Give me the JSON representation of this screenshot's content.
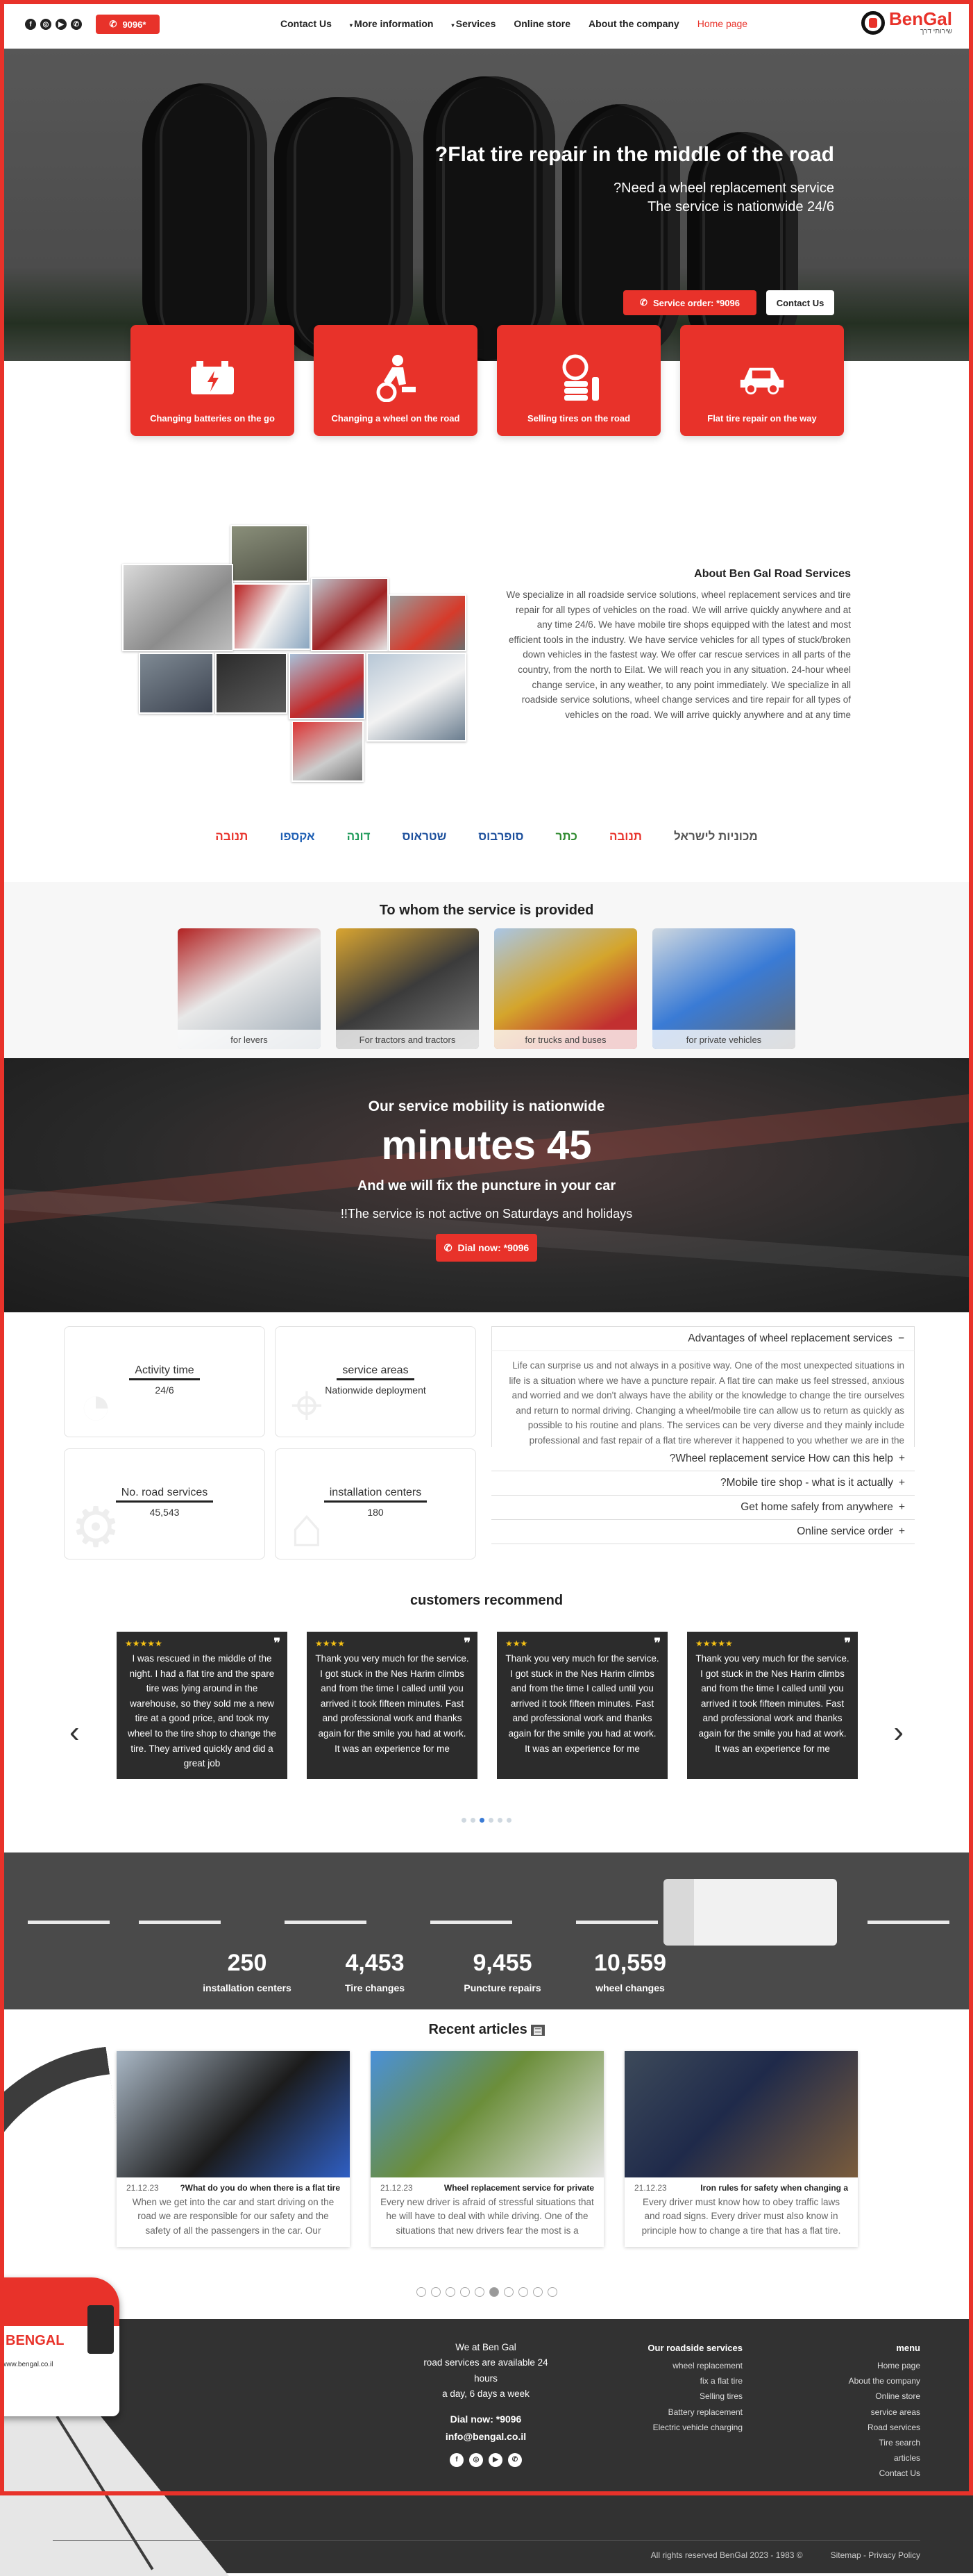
{
  "header": {
    "call_label": "9096*",
    "nav": [
      "Contact Us",
      "More information",
      "Services",
      "Online store",
      "About the company",
      "Home page"
    ],
    "logo_name": "BenGal",
    "logo_tagline": "שירותי דרך"
  },
  "hero": {
    "title": "?Flat tire repair in the middle of the road",
    "sub1": "?Need a wheel replacement service",
    "sub2": "The service is nationwide 24/6",
    "order_btn": "Service order: *9096",
    "contact_btn": "Contact Us"
  },
  "services": [
    {
      "label": "Changing batteries on the go",
      "icon": "battery-icon"
    },
    {
      "label": "Changing a wheel on the road",
      "icon": "mechanic-icon"
    },
    {
      "label": "Selling tires on the road",
      "icon": "tires-icon"
    },
    {
      "label": "Flat tire repair on the way",
      "icon": "car-icon"
    }
  ],
  "about": {
    "title": "About Ben Gal Road Services",
    "body": "We specialize in all roadside service solutions, wheel replacement services and tire repair for all types of vehicles on the road. We will arrive quickly anywhere and at any time 24/6. We have mobile tire shops equipped with the latest and most efficient tools in the industry. We have service vehicles for all types of stuck/broken down vehicles in the fastest way. We offer car rescue services in all parts of the country, from the north to Eilat. We will reach you in any situation. 24-hour wheel change service, in any weather, to any point immediately. We specialize in all roadside service solutions, wheel change services and tire repair for all types of vehicles on the road. We will arrive quickly anywhere and at any time"
  },
  "partners": [
    {
      "name": "תנובה",
      "color": "#e8322a"
    },
    {
      "name": "אקספו",
      "color": "#1e5fb4"
    },
    {
      "name": "דונה",
      "color": "#1e9a5a"
    },
    {
      "name": "שטראוס",
      "color": "#1c4f9c"
    },
    {
      "name": "סופרבוס",
      "color": "#1c4f9c"
    },
    {
      "name": "כתר",
      "color": "#2f8a2f"
    },
    {
      "name": "תנובה",
      "color": "#e8322a"
    },
    {
      "name": "מכוניות לישראל",
      "color": "#555555"
    }
  ],
  "audience": {
    "title": "To whom the service is provided",
    "items": [
      "for levers",
      "For tractors and tractors",
      "for trucks and buses",
      "for private vehicles"
    ]
  },
  "mobility": {
    "s1": "Our service mobility is nationwide",
    "big": "minutes 45",
    "s2": "And we will fix the puncture in your car",
    "s3": "!!The service is not active on Saturdays and holidays",
    "btn": "Dial now: *9096"
  },
  "stats": [
    {
      "title": "Activity time",
      "value": "24/6",
      "icon": "speed-icon"
    },
    {
      "title": "service areas",
      "value": "Nationwide deployment",
      "icon": "map-pin-icon"
    },
    {
      "title": "No. road services",
      "value": "45,543",
      "icon": "gear-icon"
    },
    {
      "title": "installation centers",
      "value": "180",
      "icon": "garage-icon"
    }
  ],
  "faq": {
    "open_title": "Advantages of wheel replacement services",
    "open_body": "Life can surprise us and not always in a positive way. One of the most unexpected situations in life is a situation where we have a puncture repair. A flat tire can make us feel stressed, anxious and worried and we don't always have the ability or the knowledge to change the tire ourselves and return to normal driving. Changing a wheel/mobile tire can allow us to return as quickly as possible to his routine and plans. The services can be very diverse and they mainly include professional and fast repair of a flat tire wherever it happened to you whether we are in the center of the country in Gush Dan or in the Sharon",
    "items": [
      "?Wheel replacement service How can this help",
      "?Mobile tire shop - what is it actually",
      "Get home safely from anywhere",
      "Online service order"
    ]
  },
  "testimonials": {
    "title": "customers recommend",
    "items": [
      {
        "stars": "★★★★★",
        "text": "I was rescued in the middle of the night. I had a flat tire and the spare tire was lying around in the warehouse, so they sold me a new tire at a good price, and took my wheel to the tire shop to change the tire. They arrived quickly and did a great job"
      },
      {
        "stars": "★★★★",
        "text": "Thank you very much for the service. I got stuck in the Nes Harim climbs and from the time I called until you arrived it took fifteen minutes. Fast and professional work and thanks again for the smile you had at work. It was an experience for me"
      },
      {
        "stars": "★★★",
        "text": "Thank you very much for the service. I got stuck in the Nes Harim climbs and from the time I called until you arrived it took fifteen minutes. Fast and professional work and thanks again for the smile you had at work. It was an experience for me"
      },
      {
        "stars": "★★★★★",
        "text": "Thank you very much for the service. I got stuck in the Nes Harim climbs and from the time I called until you arrived it took fifteen minutes. Fast and professional work and thanks again for the smile you had at work. It was an experience for me"
      }
    ],
    "dots": 6,
    "active_dot": 2
  },
  "counters": [
    {
      "value": "250",
      "label": "installation centers"
    },
    {
      "value": "4,453",
      "label": "Tire changes"
    },
    {
      "value": "9,455",
      "label": "Puncture repairs"
    },
    {
      "value": "10,559",
      "label": "wheel changes"
    }
  ],
  "articles": {
    "title": "Recent articles",
    "items": [
      {
        "date": "21.12.23",
        "title": "?What do you do when there is a flat tire",
        "excerpt": "When we get into the car and start driving on the road we are responsible for our safety and the safety of all the passengers in the car. Our"
      },
      {
        "date": "21.12.23",
        "title": "Wheel replacement service for private",
        "excerpt": "Every new driver is afraid of stressful situations that he will have to deal with while driving. One of the situations that new drivers fear the most is a"
      },
      {
        "date": "21.12.23",
        "title": "Iron rules for safety when changing a",
        "excerpt": "Every driver must know how to obey traffic laws and road signs. Every driver must also know in principle how to change a tire that has a flat tire."
      }
    ],
    "dots": 10,
    "active_dot": 5
  },
  "footer": {
    "about_lines": [
      "We at Ben Gal",
      "road services are available 24",
      "hours",
      "a day, 6 days a week"
    ],
    "dial": "Dial now: *9096",
    "email": "info@bengal.co.il",
    "services_title": "Our roadside services",
    "services": [
      "wheel replacement",
      "fix a flat tire",
      "Selling tires",
      "Battery replacement",
      "Electric vehicle charging"
    ],
    "menu_title": "menu",
    "menu": [
      "Home page",
      "About the company",
      "Online store",
      "service areas",
      "Road services",
      "Tire search",
      "articles",
      "Contact Us"
    ],
    "copyright": "All rights reserved BenGal 2023 - 1983 ©",
    "legal": "Sitemap - Privacy Policy",
    "van_logo": "BENGAL",
    "van_site": "www.bengal.co.il"
  }
}
